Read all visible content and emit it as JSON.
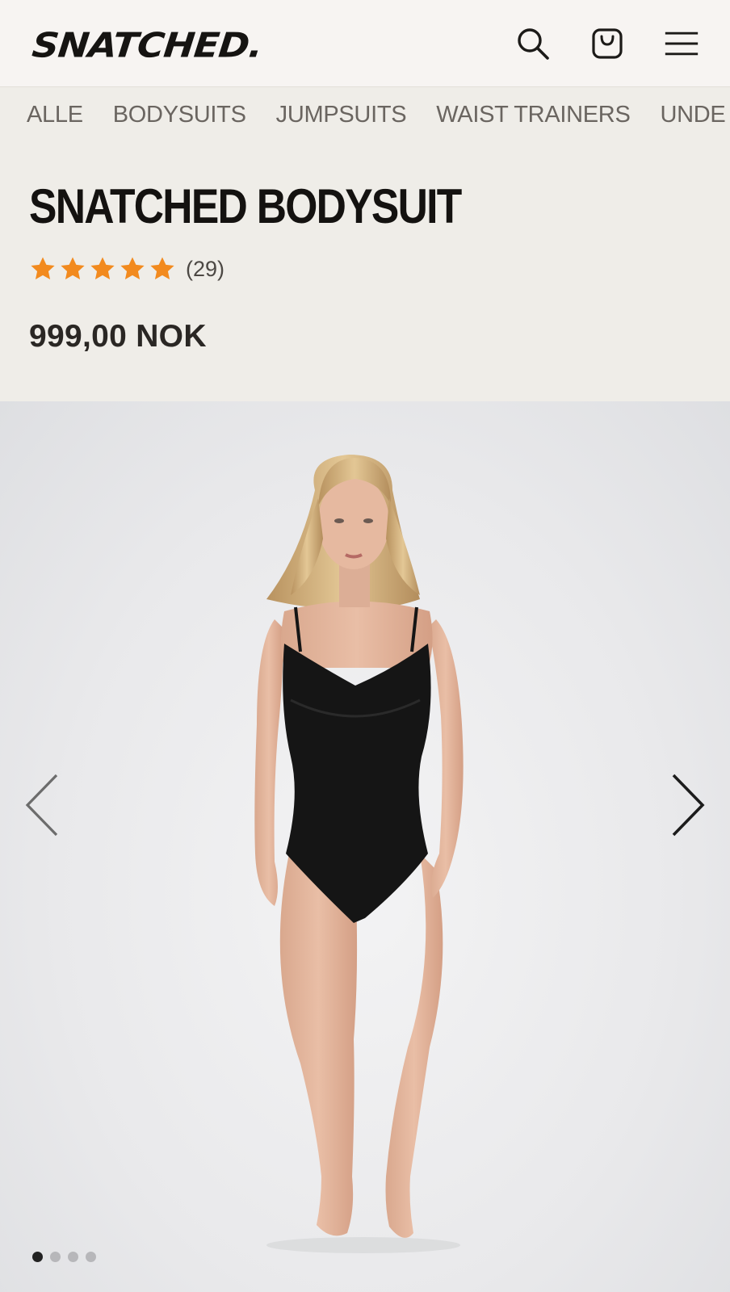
{
  "header": {
    "logo": "SNATCHED.",
    "search_icon": "search-icon",
    "cart_icon": "shopping-bag-icon",
    "menu_icon": "hamburger-menu-icon"
  },
  "categories": [
    "ALLE",
    "BODYSUITS",
    "JUMPSUITS",
    "WAIST TRAINERS",
    "UNDE"
  ],
  "product": {
    "title": "SNATCHED BODYSUIT",
    "rating_value": 5,
    "rating_max": 5,
    "rating_count": "(29)",
    "price": "999,00 NOK"
  },
  "gallery": {
    "prev_icon": "chevron-left-icon",
    "next_icon": "chevron-right-icon",
    "slide_count": 4,
    "active_slide": 1
  },
  "colors": {
    "accent_star": "#f28a1e",
    "background": "#efede8",
    "header_bg": "#f7f4f2"
  }
}
